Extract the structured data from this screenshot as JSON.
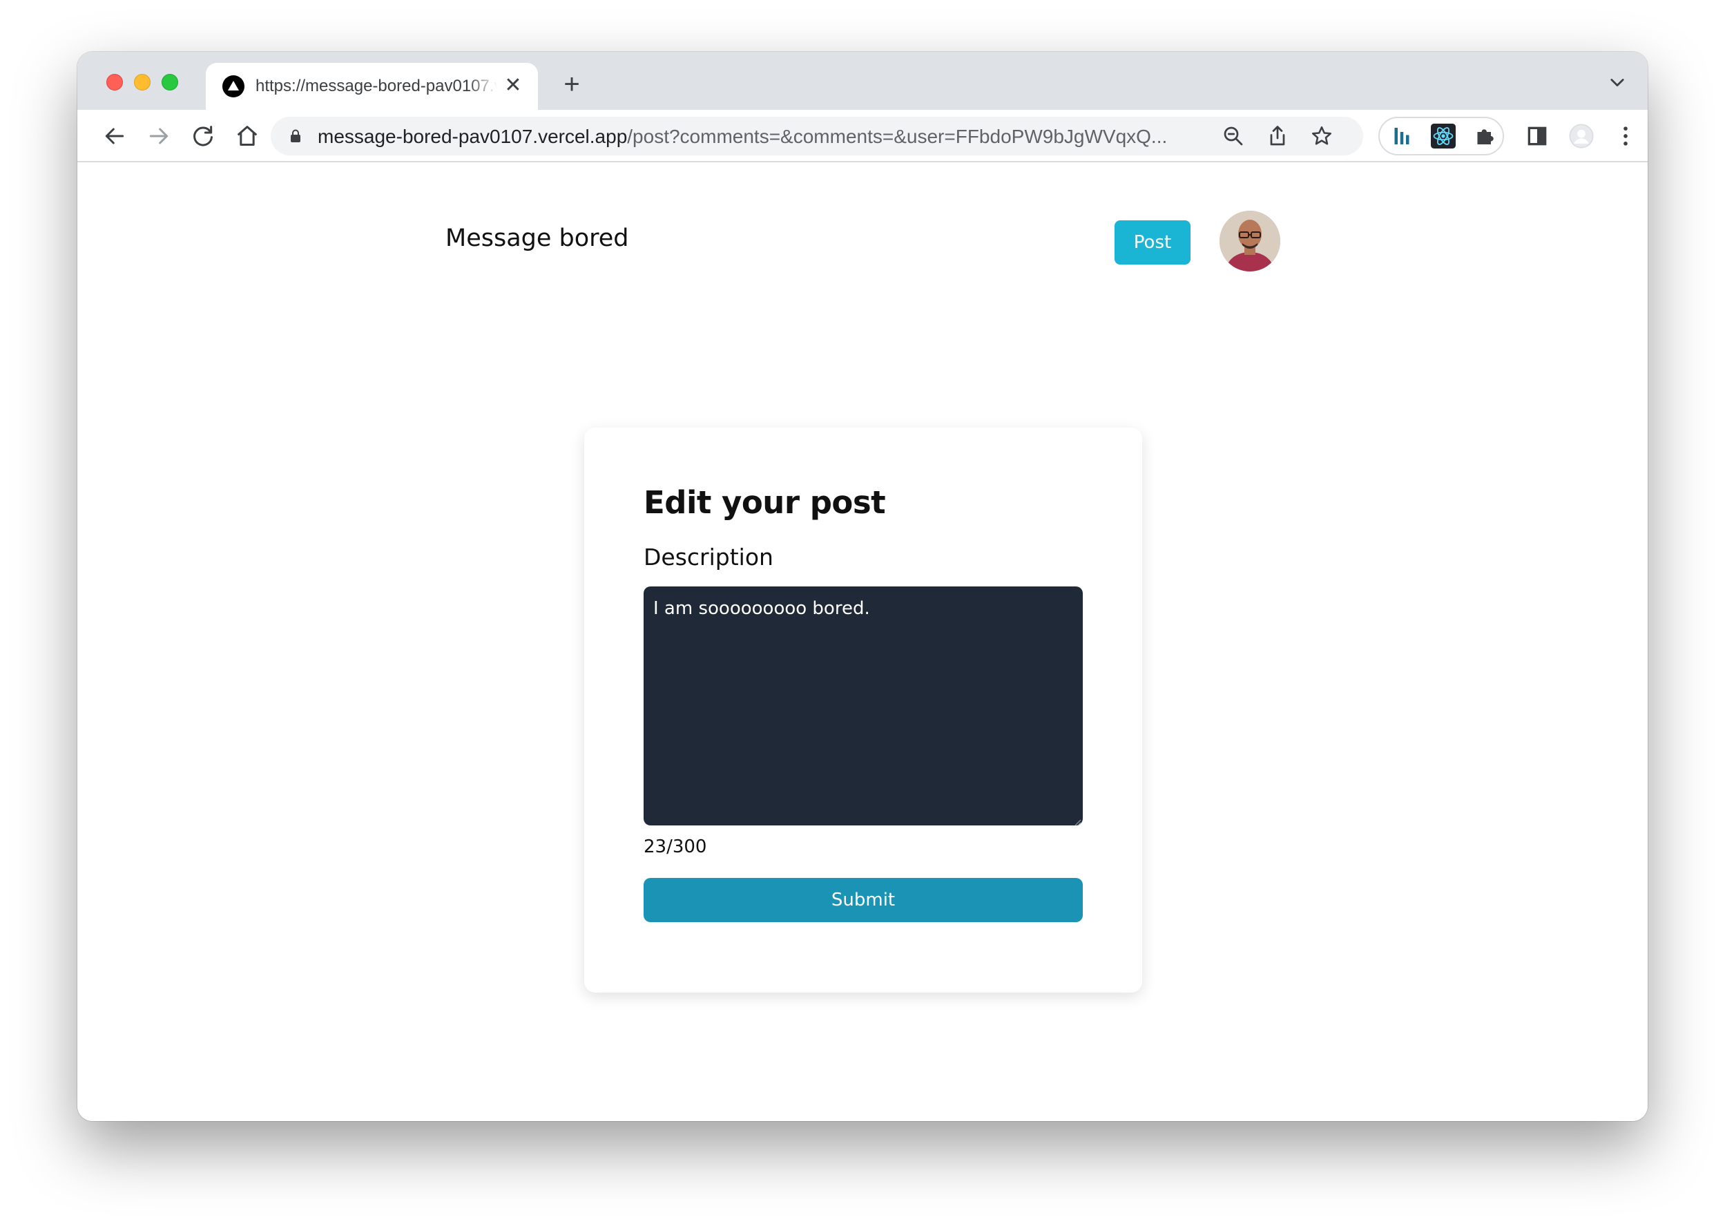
{
  "browser": {
    "tab": {
      "title": "https://message-bored-pav0107.vercel.app",
      "favicon": "vercel-triangle-icon"
    },
    "new_tab_label": "+",
    "address": {
      "host": "message-bored-pav0107.vercel.app",
      "path": "/post?comments=&comments=&user=FFbdoPW9bJgWVqxQ..."
    },
    "icons": [
      "back-icon",
      "forward-icon",
      "reload-icon",
      "home-icon",
      "lock-icon",
      "zoom-icon",
      "share-icon",
      "star-icon",
      "extension-chart-icon",
      "react-devtools-icon",
      "puzzle-icon",
      "side-panel-icon",
      "profile-icon",
      "more-icon"
    ]
  },
  "header": {
    "brand": "Message bored",
    "post_button": "Post"
  },
  "form": {
    "title": "Edit your post",
    "description_label": "Description",
    "description_value": "I am sooooooooo bored.",
    "counter": "23/300",
    "submit_label": "Submit"
  },
  "colors": {
    "post_button": "#1ab5d4",
    "submit_button": "#1b93b4",
    "textarea_bg": "#1f2937"
  }
}
